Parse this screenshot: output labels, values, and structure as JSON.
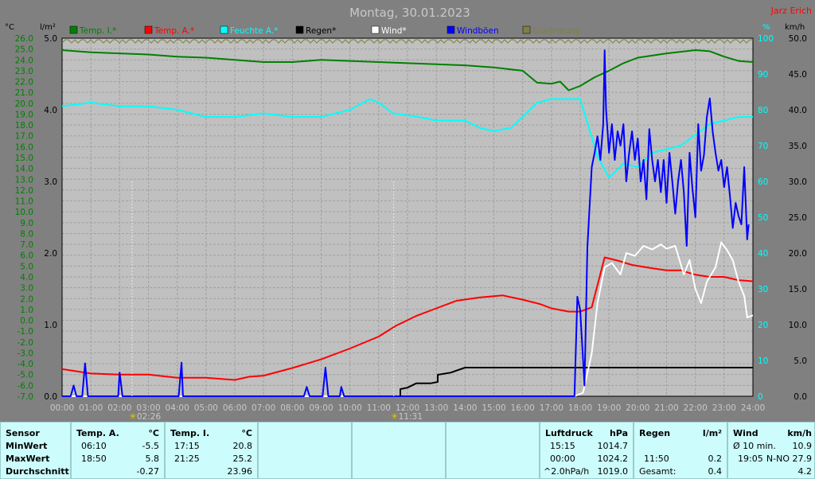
{
  "title": "Montag, 30.01.2023",
  "author": "Jarz Erich",
  "units": {
    "temp": "°C",
    "rain": "l/m²",
    "humidity": "%",
    "wind": "km/h"
  },
  "legend": [
    {
      "label": "Temp. I.*",
      "color": "#008000"
    },
    {
      "label": "Temp. A.*",
      "color": "#ff0000"
    },
    {
      "label": "Feuchte A.*",
      "color": "#00ffff"
    },
    {
      "label": "Regen*",
      "color": "#000000"
    },
    {
      "label": "Wind*",
      "color": "#ffffff"
    },
    {
      "label": "Windböen",
      "color": "#0000ff"
    },
    {
      "label": "Erwärmung",
      "color": "#808040"
    }
  ],
  "chart_data": {
    "type": "line",
    "x_unit": "hours",
    "x_ticks": [
      "00:00",
      "01:00",
      "02:00",
      "03:00",
      "04:00",
      "05:00",
      "06:00",
      "07:00",
      "08:00",
      "09:00",
      "10:00",
      "11:00",
      "12:00",
      "13:00",
      "14:00",
      "15:00",
      "16:00",
      "17:00",
      "18:00",
      "19:00",
      "20:00",
      "21:00",
      "22:00",
      "23:00",
      "24:00"
    ],
    "xlim": [
      0,
      24
    ],
    "temp_axis": {
      "ylim": [
        -7,
        26
      ],
      "ticks": [
        "26.0",
        "25.0",
        "24.0",
        "23.0",
        "22.0",
        "21.0",
        "20.0",
        "19.0",
        "18.0",
        "17.0",
        "16.0",
        "15.0",
        "14.0",
        "13.0",
        "12.0",
        "11.0",
        "10.0",
        "9.0",
        "8.0",
        "7.0",
        "6.0",
        "5.0",
        "4.0",
        "3.0",
        "2.0",
        "1.0",
        "0.0",
        "-1.0",
        "-2.0",
        "-3.0",
        "-4.0",
        "-5.0",
        "-6.0",
        "-7.0"
      ]
    },
    "rain_axis": {
      "ylim": [
        0,
        5
      ],
      "ticks": [
        "5.0",
        "4.0",
        "3.0",
        "2.0",
        "1.0",
        "0.0"
      ]
    },
    "humidity_axis": {
      "ylim": [
        0,
        100
      ],
      "ticks": [
        "100",
        "90",
        "80",
        "70",
        "60",
        "50",
        "40",
        "30",
        "20",
        "10",
        "0"
      ]
    },
    "wind_axis": {
      "ylim": [
        0,
        50
      ],
      "ticks": [
        "50.0",
        "45.0",
        "40.0",
        "35.0",
        "30.0",
        "25.0",
        "20.0",
        "15.0",
        "10.0",
        "5.0",
        "0.0"
      ]
    },
    "sun_markers": [
      {
        "x": 2.43,
        "label": "02:26"
      },
      {
        "x": 11.52,
        "label": "11:31"
      }
    ],
    "series": [
      {
        "name": "Temp. I.*",
        "color": "#008000",
        "axis": "temp",
        "points": [
          [
            0,
            24.9
          ],
          [
            1,
            24.7
          ],
          [
            2,
            24.6
          ],
          [
            3,
            24.5
          ],
          [
            4,
            24.3
          ],
          [
            5,
            24.2
          ],
          [
            6,
            24.0
          ],
          [
            7,
            23.8
          ],
          [
            8,
            23.8
          ],
          [
            9,
            24.0
          ],
          [
            10,
            23.9
          ],
          [
            11,
            23.8
          ],
          [
            12,
            23.7
          ],
          [
            13,
            23.6
          ],
          [
            14,
            23.5
          ],
          [
            15,
            23.3
          ],
          [
            16,
            23.0
          ],
          [
            16.5,
            21.9
          ],
          [
            17,
            21.8
          ],
          [
            17.3,
            22.0
          ],
          [
            17.6,
            21.2
          ],
          [
            18,
            21.6
          ],
          [
            18.5,
            22.4
          ],
          [
            19,
            23.0
          ],
          [
            19.5,
            23.7
          ],
          [
            20,
            24.2
          ],
          [
            21,
            24.6
          ],
          [
            22,
            24.9
          ],
          [
            22.5,
            24.8
          ],
          [
            23,
            24.3
          ],
          [
            23.5,
            23.9
          ],
          [
            24,
            23.8
          ]
        ]
      },
      {
        "name": "Temp. A.*",
        "color": "#ff0000",
        "axis": "temp",
        "points": [
          [
            0,
            -4.5
          ],
          [
            1,
            -4.9
          ],
          [
            2,
            -5.0
          ],
          [
            3,
            -5.0
          ],
          [
            4,
            -5.3
          ],
          [
            5,
            -5.3
          ],
          [
            6,
            -5.5
          ],
          [
            6.5,
            -5.2
          ],
          [
            7,
            -5.1
          ],
          [
            8,
            -4.4
          ],
          [
            9,
            -3.6
          ],
          [
            10,
            -2.6
          ],
          [
            11,
            -1.5
          ],
          [
            11.6,
            -0.5
          ],
          [
            12.3,
            0.4
          ],
          [
            13,
            1.1
          ],
          [
            13.7,
            1.8
          ],
          [
            14.5,
            2.1
          ],
          [
            15.3,
            2.3
          ],
          [
            16,
            1.9
          ],
          [
            16.6,
            1.5
          ],
          [
            17,
            1.1
          ],
          [
            17.6,
            0.8
          ],
          [
            18,
            0.8
          ],
          [
            18.4,
            1.2
          ],
          [
            18.85,
            5.8
          ],
          [
            19.3,
            5.5
          ],
          [
            19.8,
            5.1
          ],
          [
            20.5,
            4.8
          ],
          [
            21,
            4.6
          ],
          [
            21.5,
            4.6
          ],
          [
            22,
            4.2
          ],
          [
            22.5,
            4.0
          ],
          [
            23,
            4.0
          ],
          [
            23.5,
            3.7
          ],
          [
            24,
            3.6
          ]
        ]
      },
      {
        "name": "Feuchte A.*",
        "color": "#00ffff",
        "axis": "humidity",
        "points": [
          [
            0,
            81
          ],
          [
            1,
            82
          ],
          [
            2,
            81
          ],
          [
            3,
            81
          ],
          [
            4,
            80
          ],
          [
            4.5,
            79
          ],
          [
            5,
            78
          ],
          [
            6,
            78
          ],
          [
            7,
            79
          ],
          [
            8,
            78
          ],
          [
            9,
            78
          ],
          [
            10,
            80
          ],
          [
            10.7,
            83
          ],
          [
            11,
            82
          ],
          [
            11.5,
            79
          ],
          [
            12.4,
            78
          ],
          [
            13,
            77
          ],
          [
            14,
            77
          ],
          [
            14.5,
            75
          ],
          [
            15,
            74
          ],
          [
            15.6,
            75
          ],
          [
            16,
            78
          ],
          [
            16.5,
            82
          ],
          [
            17,
            83
          ],
          [
            17.5,
            83
          ],
          [
            18,
            83
          ],
          [
            18.3,
            75
          ],
          [
            18.6,
            67
          ],
          [
            19,
            61
          ],
          [
            19.5,
            65
          ],
          [
            20,
            64
          ],
          [
            20.5,
            68
          ],
          [
            21,
            69
          ],
          [
            21.5,
            70
          ],
          [
            22,
            73
          ],
          [
            22.5,
            76
          ],
          [
            23,
            77
          ],
          [
            23.5,
            78
          ],
          [
            24,
            78
          ]
        ]
      },
      {
        "name": "Regen*",
        "color": "#000000",
        "axis": "rain",
        "points": [
          [
            0,
            0
          ],
          [
            11.75,
            0
          ],
          [
            11.75,
            0.1
          ],
          [
            12,
            0.12
          ],
          [
            12.3,
            0.18
          ],
          [
            12.8,
            0.18
          ],
          [
            13.05,
            0.2
          ],
          [
            13.05,
            0.3
          ],
          [
            13.5,
            0.33
          ],
          [
            14,
            0.4
          ],
          [
            24,
            0.4
          ]
        ]
      },
      {
        "name": "Wind*",
        "color": "#ffffff",
        "axis": "wind",
        "points": [
          [
            0,
            0
          ],
          [
            17.8,
            0
          ],
          [
            18.1,
            0.5
          ],
          [
            18.4,
            6
          ],
          [
            18.6,
            13
          ],
          [
            18.85,
            18
          ],
          [
            19.1,
            18.6
          ],
          [
            19.4,
            17
          ],
          [
            19.6,
            20
          ],
          [
            19.9,
            19.6
          ],
          [
            20.2,
            21
          ],
          [
            20.5,
            20.5
          ],
          [
            20.8,
            21.2
          ],
          [
            21,
            20.6
          ],
          [
            21.3,
            21
          ],
          [
            21.6,
            17
          ],
          [
            21.8,
            19
          ],
          [
            22,
            15
          ],
          [
            22.2,
            13
          ],
          [
            22.4,
            16
          ],
          [
            22.7,
            18
          ],
          [
            22.9,
            21.5
          ],
          [
            23.1,
            20.4
          ],
          [
            23.3,
            19
          ],
          [
            23.5,
            16
          ],
          [
            23.7,
            14
          ],
          [
            23.8,
            11
          ],
          [
            24,
            11.3
          ]
        ]
      },
      {
        "name": "Windböen",
        "color": "#0000ff",
        "axis": "wind",
        "points": [
          [
            0,
            0
          ],
          [
            0.3,
            0
          ],
          [
            0.4,
            1.5
          ],
          [
            0.5,
            0
          ],
          [
            0.7,
            0
          ],
          [
            0.8,
            4.6
          ],
          [
            0.9,
            0
          ],
          [
            1.95,
            0
          ],
          [
            2.0,
            3.3
          ],
          [
            2.1,
            0
          ],
          [
            4.05,
            0
          ],
          [
            4.15,
            4.7
          ],
          [
            4.2,
            0
          ],
          [
            8.4,
            0
          ],
          [
            8.5,
            1.3
          ],
          [
            8.6,
            0
          ],
          [
            9.05,
            0
          ],
          [
            9.15,
            4
          ],
          [
            9.25,
            0
          ],
          [
            9.65,
            0
          ],
          [
            9.7,
            1.3
          ],
          [
            9.8,
            0
          ],
          [
            17.8,
            0
          ],
          [
            17.9,
            13.9
          ],
          [
            18.0,
            12
          ],
          [
            18.15,
            1.5
          ],
          [
            18.25,
            20.8
          ],
          [
            18.4,
            32
          ],
          [
            18.5,
            34
          ],
          [
            18.6,
            36.3
          ],
          [
            18.7,
            33
          ],
          [
            18.8,
            38
          ],
          [
            18.85,
            48.3
          ],
          [
            18.9,
            40
          ],
          [
            19.0,
            34
          ],
          [
            19.1,
            38
          ],
          [
            19.2,
            33
          ],
          [
            19.3,
            37
          ],
          [
            19.4,
            35
          ],
          [
            19.5,
            38
          ],
          [
            19.6,
            30
          ],
          [
            19.7,
            34
          ],
          [
            19.8,
            37
          ],
          [
            19.9,
            33
          ],
          [
            20.0,
            36
          ],
          [
            20.1,
            30
          ],
          [
            20.2,
            33
          ],
          [
            20.3,
            27.5
          ],
          [
            20.4,
            37.3
          ],
          [
            20.5,
            33
          ],
          [
            20.6,
            30
          ],
          [
            20.7,
            33
          ],
          [
            20.8,
            28.5
          ],
          [
            20.9,
            33
          ],
          [
            21.0,
            27
          ],
          [
            21.1,
            34
          ],
          [
            21.2,
            30
          ],
          [
            21.3,
            25.5
          ],
          [
            21.4,
            30
          ],
          [
            21.5,
            33
          ],
          [
            21.6,
            28.5
          ],
          [
            21.7,
            21
          ],
          [
            21.8,
            34
          ],
          [
            21.9,
            29
          ],
          [
            22.0,
            25
          ],
          [
            22.1,
            38
          ],
          [
            22.2,
            31.5
          ],
          [
            22.3,
            33.7
          ],
          [
            22.4,
            39
          ],
          [
            22.5,
            41.6
          ],
          [
            22.6,
            37
          ],
          [
            22.7,
            34
          ],
          [
            22.8,
            31.5
          ],
          [
            22.9,
            33
          ],
          [
            23.0,
            29.2
          ],
          [
            23.1,
            32
          ],
          [
            23.2,
            28
          ],
          [
            23.3,
            23.5
          ],
          [
            23.4,
            27
          ],
          [
            23.5,
            25.2
          ],
          [
            23.6,
            24
          ],
          [
            23.7,
            32
          ],
          [
            23.8,
            21.9
          ],
          [
            23.85,
            24
          ]
        ]
      }
    ]
  },
  "table": {
    "sensor": {
      "header": "Sensor",
      "rows": [
        "MinWert",
        "MaxWert",
        "Durchschnitt"
      ]
    },
    "temp_a": {
      "header": "Temp. A.",
      "unit": "°C",
      "rows": [
        [
          "06:10",
          "-5.5"
        ],
        [
          "18:50",
          "5.8"
        ],
        [
          "",
          "-0.27"
        ]
      ]
    },
    "temp_i": {
      "header": "Temp. I.",
      "unit": "°C",
      "rows": [
        [
          "17:15",
          "20.8"
        ],
        [
          "21:25",
          "25.2"
        ],
        [
          "",
          "23.96"
        ]
      ]
    },
    "pressure": {
      "header": "Luftdruck",
      "unit": "hPa",
      "rows": [
        [
          "15:15",
          "1014.7"
        ],
        [
          "00:00",
          "1024.2"
        ],
        [
          "^2.0hPa/h",
          "1019.0"
        ]
      ]
    },
    "rain": {
      "header": "Regen",
      "unit": "l/m²",
      "rows": [
        [
          "",
          ""
        ],
        [
          "11:50",
          "0.2"
        ],
        [
          "Gesamt:",
          "0.4"
        ]
      ]
    },
    "wind": {
      "header": "Wind",
      "unit": "km/h",
      "rows": [
        [
          "Ø 10 min.",
          "10.9"
        ],
        [
          "19:05",
          "N-NO 27.9"
        ],
        [
          "",
          "4.2"
        ]
      ]
    }
  }
}
